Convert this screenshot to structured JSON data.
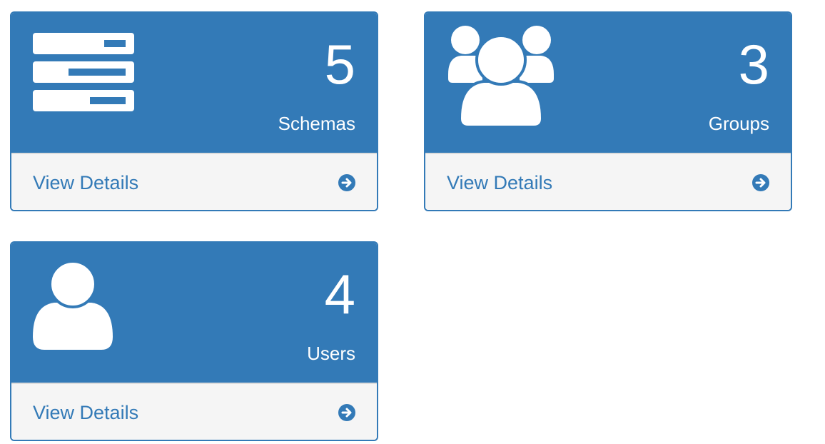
{
  "colors": {
    "primary": "#337ab7",
    "footer_bg": "#f5f5f5",
    "icon": "#ffffff"
  },
  "panels": [
    {
      "count": "5",
      "label": "Schemas",
      "link_label": "View Details",
      "icon": "server-stack-icon"
    },
    {
      "count": "3",
      "label": "Groups",
      "link_label": "View Details",
      "icon": "group-icon"
    },
    {
      "count": "4",
      "label": "Users",
      "link_label": "View Details",
      "icon": "user-icon"
    }
  ]
}
